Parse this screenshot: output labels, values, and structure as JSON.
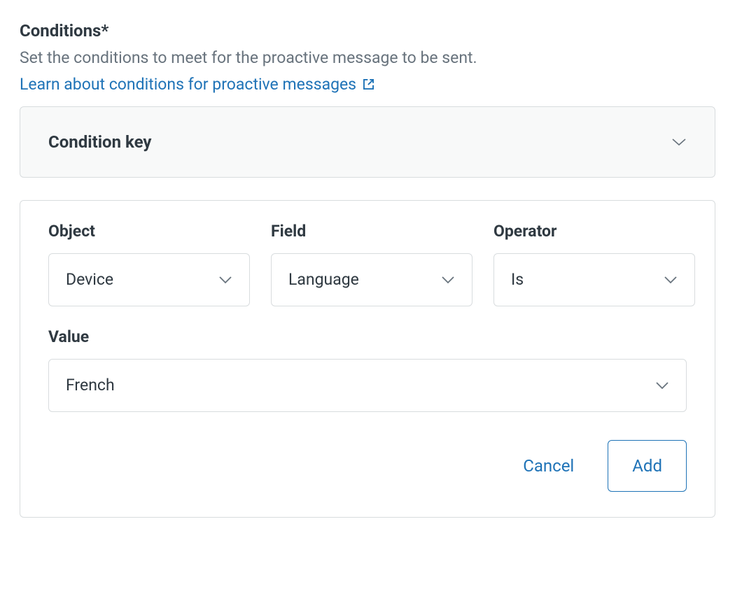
{
  "section": {
    "title": "Conditions*",
    "description": "Set the conditions to meet for the proactive message to be sent.",
    "learn_link_text": "Learn about conditions for proactive messages"
  },
  "condition_key": {
    "title": "Condition key"
  },
  "form": {
    "object": {
      "label": "Object",
      "value": "Device"
    },
    "field": {
      "label": "Field",
      "value": "Language"
    },
    "operator": {
      "label": "Operator",
      "value": "Is"
    },
    "value": {
      "label": "Value",
      "value": "French"
    },
    "actions": {
      "cancel": "Cancel",
      "add": "Add"
    }
  }
}
